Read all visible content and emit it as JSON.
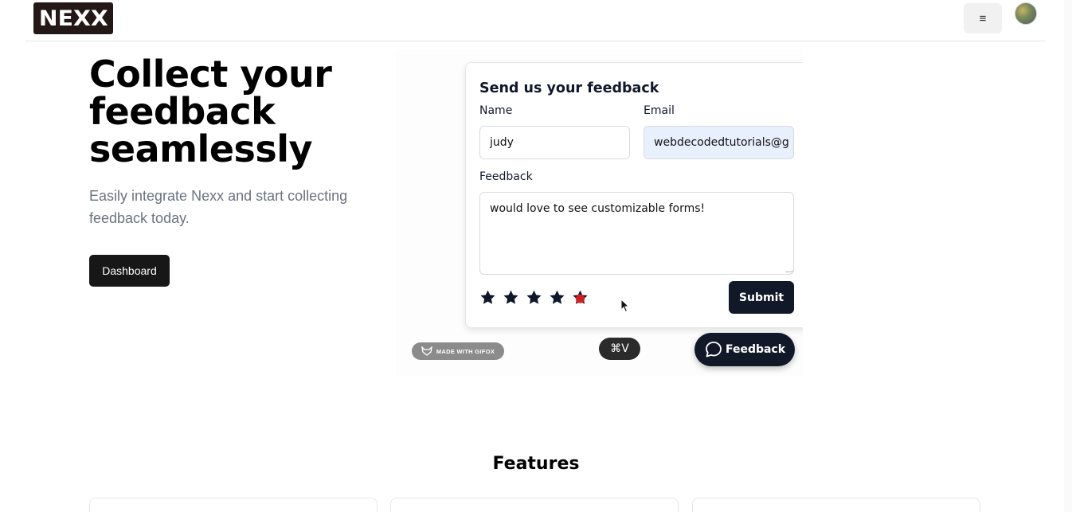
{
  "header": {
    "logo_text": "NEXX",
    "logo_tm": "™",
    "menu_icon": "≡",
    "avatar_icon": "avatar"
  },
  "hero": {
    "title": "Collect your feedback seamlessly",
    "subtitle": "Easily integrate Nexx and start collecting feedback today.",
    "dashboard_button": "Dashboard"
  },
  "feedback_form": {
    "title": "Send us your feedback",
    "name_label": "Name",
    "name_value": "judy",
    "email_label": "Email",
    "email_value": "webdecodedtutorials@g",
    "feedback_label": "Feedback",
    "feedback_value": "would love to see customizable forms!",
    "rating": 5,
    "rating_max": 5,
    "submit_label": "Submit"
  },
  "overlay": {
    "gifox_badge": "MADE WITH GIFOX",
    "shortcut": "⌘V",
    "feedback_button": "Feedback"
  },
  "features": {
    "title": "Features"
  },
  "colors": {
    "primary_dark": "#111827",
    "button_dark": "#171717",
    "email_autofill": "#e8f0fe",
    "star": "#0f172a",
    "star_active": "#e02020"
  }
}
